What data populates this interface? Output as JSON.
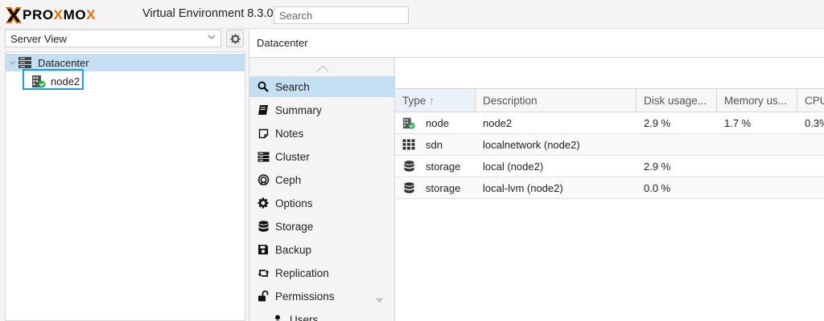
{
  "header": {
    "logo_prefix": "PRO",
    "logo_x": "X",
    "logo_mo": "MO",
    "logo_x2": "X",
    "version": "Virtual Environment 8.3.0",
    "search_placeholder": "Search"
  },
  "sidebar": {
    "view_select": "Server View",
    "tree": [
      {
        "label": "Datacenter",
        "icon": "datacenter-icon"
      },
      {
        "label": "node2",
        "icon": "node-online-icon"
      }
    ]
  },
  "breadcrumb": "Datacenter",
  "nav": {
    "items": [
      {
        "label": "Search",
        "icon": "search-icon"
      },
      {
        "label": "Summary",
        "icon": "book-icon"
      },
      {
        "label": "Notes",
        "icon": "notes-icon"
      },
      {
        "label": "Cluster",
        "icon": "server-icon"
      },
      {
        "label": "Ceph",
        "icon": "ceph-icon"
      },
      {
        "label": "Options",
        "icon": "gear-icon"
      },
      {
        "label": "Storage",
        "icon": "database-icon"
      },
      {
        "label": "Backup",
        "icon": "floppy-icon"
      },
      {
        "label": "Replication",
        "icon": "retweet-icon"
      },
      {
        "label": "Permissions",
        "icon": "unlock-icon"
      },
      {
        "label": "Users",
        "icon": "user-icon"
      }
    ]
  },
  "grid": {
    "columns": [
      "Type",
      "Description",
      "Disk usage...",
      "Memory us...",
      "CPU"
    ],
    "sort_indicator": "↑",
    "rows": [
      {
        "type": "node",
        "description": "node2",
        "disk": "2.9 %",
        "memory": "1.7 %",
        "cpu": "0.3%",
        "icon": "node-online-icon"
      },
      {
        "type": "sdn",
        "description": "localnetwork (node2)",
        "disk": "",
        "memory": "",
        "cpu": "",
        "icon": "sdn-grid-icon"
      },
      {
        "type": "storage",
        "description": "local (node2)",
        "disk": "2.9 %",
        "memory": "",
        "cpu": "",
        "icon": "database-icon"
      },
      {
        "type": "storage",
        "description": "local-lvm (node2)",
        "disk": "0.0 %",
        "memory": "",
        "cpu": "",
        "icon": "database-icon"
      }
    ]
  },
  "colors": {
    "accent": "#e57000",
    "selection": "#c5dff2",
    "focus_outline": "#1a9fda",
    "online_green": "#21b04b"
  }
}
